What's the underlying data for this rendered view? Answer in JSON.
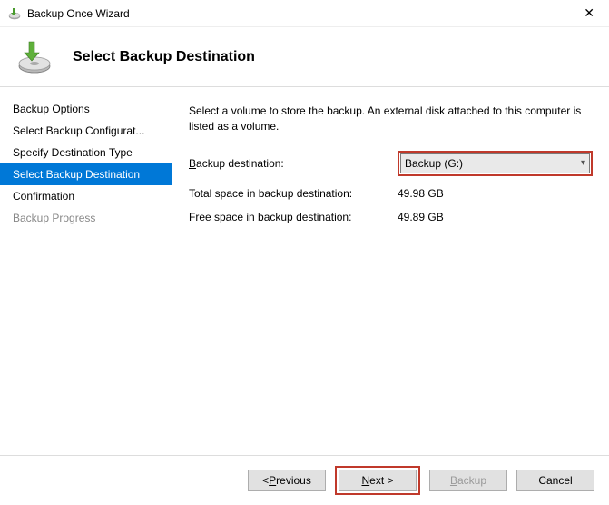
{
  "window": {
    "title": "Backup Once Wizard"
  },
  "header": {
    "title": "Select Backup Destination"
  },
  "sidebar": {
    "items": [
      {
        "label": "Backup Options"
      },
      {
        "label": "Select Backup Configurat..."
      },
      {
        "label": "Specify Destination Type"
      },
      {
        "label": "Select Backup Destination"
      },
      {
        "label": "Confirmation"
      },
      {
        "label": "Backup Progress"
      }
    ]
  },
  "content": {
    "description": "Select a volume to store the backup. An external disk attached to this computer is listed as a volume.",
    "dest_label_prefix": "B",
    "dest_label_rest": "ackup destination:",
    "dest_value": "Backup (G:)",
    "total_label": "Total space in backup destination:",
    "total_value": "49.98 GB",
    "free_label": "Free space in backup destination:",
    "free_value": "49.89 GB"
  },
  "footer": {
    "previous_prefix": "< ",
    "previous_ul": "P",
    "previous_rest": "revious",
    "next_ul": "N",
    "next_rest": "ext >",
    "backup_ul": "B",
    "backup_rest": "ackup",
    "cancel": "Cancel"
  }
}
